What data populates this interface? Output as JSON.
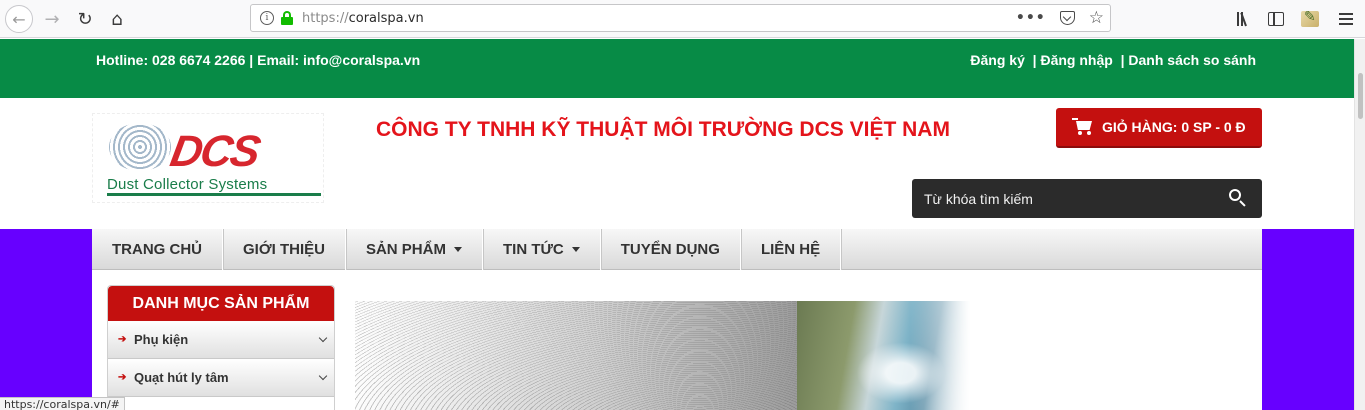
{
  "browser": {
    "url_scheme": "https://",
    "url_host": "coralspa.vn",
    "status_url": "https://coralspa.vn/#"
  },
  "topbar": {
    "hotline": "Hotline: 028 6674 2266 | Email: info@coralspa.vn",
    "register": "Đăng ký",
    "sep1": "  | ",
    "login": "Đăng nhập",
    "sep2": "  | ",
    "compare": "Danh sách so sánh"
  },
  "header": {
    "logo_letters": "DCS",
    "logo_tagline": "Dust Collector Systems",
    "company_name": "CÔNG TY TNHH KỸ THUẬT MÔI TRƯỜNG DCS VIỆT NAM",
    "cart_label": "GIỎ HÀNG: 0 SP - 0 Đ",
    "search_placeholder": "Từ khóa tìm kiếm"
  },
  "nav": {
    "items": [
      {
        "label": "TRANG CHỦ",
        "dropdown": false
      },
      {
        "label": "GIỚI THIỆU",
        "dropdown": false
      },
      {
        "label": "SẢN PHẨM",
        "dropdown": true
      },
      {
        "label": "TIN TỨC",
        "dropdown": true
      },
      {
        "label": "TUYỂN DỤNG",
        "dropdown": false
      },
      {
        "label": "LIÊN HỆ",
        "dropdown": false
      }
    ]
  },
  "categories": {
    "title": "DANH MỤC SẢN PHẨM",
    "items": [
      {
        "label": "Phụ kiện"
      },
      {
        "label": "Quạt hút ly tâm"
      }
    ]
  },
  "colors": {
    "topbar": "#078b46",
    "brand_red": "#c4100f",
    "company_red": "#e4141b",
    "background_purple": "#6700ff"
  }
}
